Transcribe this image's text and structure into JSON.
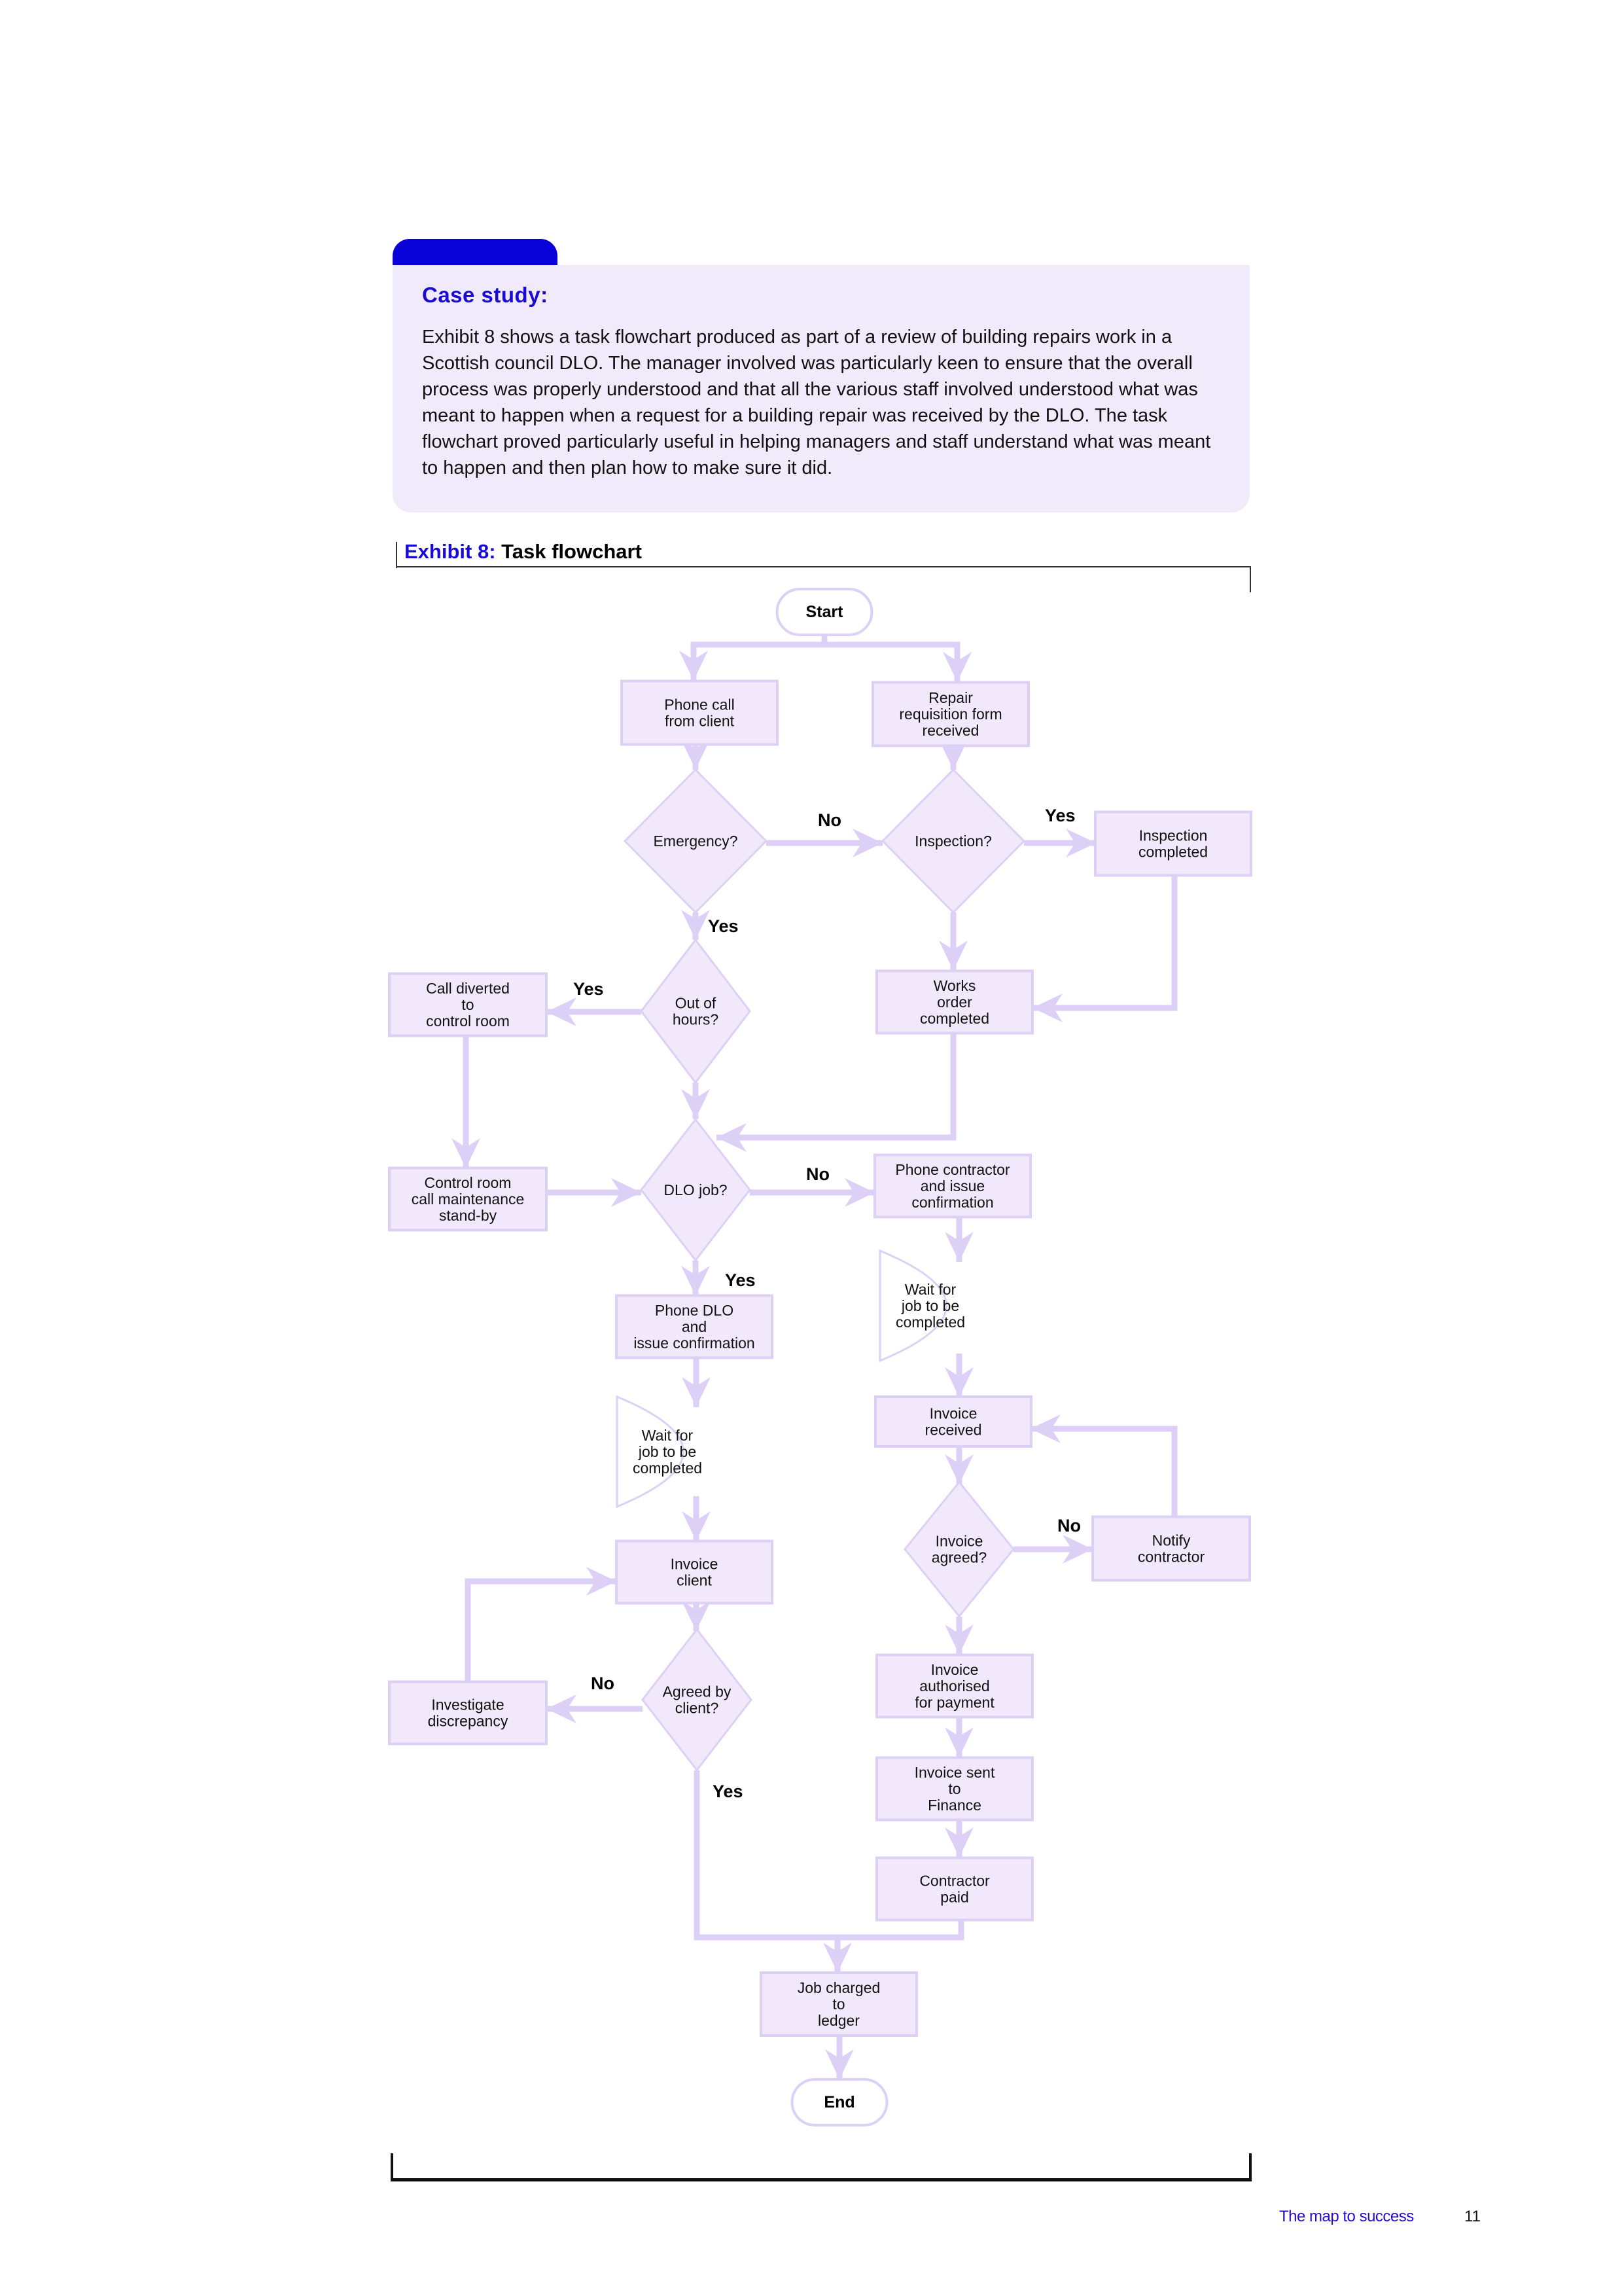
{
  "case_study": {
    "title": "Case study:",
    "body": "Exhibit 8 shows a task flowchart produced as part of a review of building repairs work in a Scottish council DLO. The manager involved was particularly keen to ensure that the overall process was properly understood and that all the various staff involved understood what was meant to happen when a request for a building repair was received by the DLO. The task flowchart proved particularly useful in helping managers and staff understand what was meant to happen and then plan how to make sure it did."
  },
  "exhibit": {
    "number_label": "Exhibit 8:",
    "title": " Task flowchart"
  },
  "colors": {
    "accent_blue": "#1a0ad6",
    "tab_blue": "#0a00d8",
    "case_bg": "#f1eafa",
    "node_fill": "#f1e9fb",
    "node_stroke": "#dcd0f5",
    "arrow": "#ddd0f7"
  },
  "flowchart": {
    "nodes": [
      {
        "id": "start",
        "type": "terminal",
        "lines": [
          "Start"
        ]
      },
      {
        "id": "phone_call",
        "type": "process",
        "lines": [
          "Phone call",
          "from client"
        ]
      },
      {
        "id": "repair_form",
        "type": "process",
        "lines": [
          "Repair",
          "requisition form",
          "received"
        ]
      },
      {
        "id": "emergency",
        "type": "decision",
        "lines": [
          "Emergency?"
        ]
      },
      {
        "id": "inspection",
        "type": "decision",
        "lines": [
          "Inspection?"
        ]
      },
      {
        "id": "inspection_completed",
        "type": "process",
        "lines": [
          "Inspection",
          "completed"
        ]
      },
      {
        "id": "out_of_hours",
        "type": "decision",
        "lines": [
          "Out of",
          "hours?"
        ]
      },
      {
        "id": "call_diverted",
        "type": "process",
        "lines": [
          "Call diverted",
          "to",
          "control room"
        ]
      },
      {
        "id": "works_order",
        "type": "process",
        "lines": [
          "Works",
          "order",
          "completed"
        ]
      },
      {
        "id": "dlo_job",
        "type": "decision",
        "lines": [
          "DLO job?"
        ]
      },
      {
        "id": "control_room",
        "type": "process",
        "lines": [
          "Control room",
          "call maintenance",
          "stand-by"
        ]
      },
      {
        "id": "phone_contractor",
        "type": "process",
        "lines": [
          "Phone contractor",
          "and issue",
          "confirmation"
        ]
      },
      {
        "id": "wait_contractor",
        "type": "delay",
        "lines": [
          "Wait for",
          "job to be",
          "completed"
        ]
      },
      {
        "id": "phone_dlo",
        "type": "process",
        "lines": [
          "Phone DLO",
          "and",
          "issue confirmation"
        ]
      },
      {
        "id": "wait_dlo",
        "type": "delay",
        "lines": [
          "Wait for",
          "job to be",
          "completed"
        ]
      },
      {
        "id": "invoice_received",
        "type": "process",
        "lines": [
          "Invoice",
          "received"
        ]
      },
      {
        "id": "invoice_agreed",
        "type": "decision",
        "lines": [
          "Invoice",
          "agreed?"
        ]
      },
      {
        "id": "notify_contractor",
        "type": "process",
        "lines": [
          "Notify",
          "contractor"
        ]
      },
      {
        "id": "invoice_client",
        "type": "process",
        "lines": [
          "Invoice",
          "client"
        ]
      },
      {
        "id": "agreed_by_client",
        "type": "decision",
        "lines": [
          "Agreed by",
          "client?"
        ]
      },
      {
        "id": "investigate",
        "type": "process",
        "lines": [
          "Investigate",
          "discrepancy"
        ]
      },
      {
        "id": "invoice_authorised",
        "type": "process",
        "lines": [
          "Invoice",
          "authorised",
          "for payment"
        ]
      },
      {
        "id": "invoice_sent",
        "type": "process",
        "lines": [
          "Invoice sent",
          "to",
          "Finance"
        ]
      },
      {
        "id": "contractor_paid",
        "type": "process",
        "lines": [
          "Contractor",
          "paid"
        ]
      },
      {
        "id": "job_charged",
        "type": "process",
        "lines": [
          "Job charged",
          "to",
          "ledger"
        ]
      },
      {
        "id": "end",
        "type": "terminal",
        "lines": [
          "End"
        ]
      }
    ],
    "edges": [
      {
        "from": "start",
        "to": "phone_call",
        "label": ""
      },
      {
        "from": "start",
        "to": "repair_form",
        "label": ""
      },
      {
        "from": "phone_call",
        "to": "emergency",
        "label": ""
      },
      {
        "from": "repair_form",
        "to": "inspection",
        "label": ""
      },
      {
        "from": "emergency",
        "to": "inspection",
        "label": "No"
      },
      {
        "from": "inspection",
        "to": "inspection_completed",
        "label": "Yes"
      },
      {
        "from": "emergency",
        "to": "out_of_hours",
        "label": "Yes"
      },
      {
        "from": "inspection",
        "to": "works_order",
        "label": ""
      },
      {
        "from": "inspection_completed",
        "to": "works_order",
        "label": ""
      },
      {
        "from": "out_of_hours",
        "to": "call_diverted",
        "label": "Yes"
      },
      {
        "from": "out_of_hours",
        "to": "dlo_job",
        "label": ""
      },
      {
        "from": "works_order",
        "to": "dlo_job",
        "label": ""
      },
      {
        "from": "call_diverted",
        "to": "control_room",
        "label": ""
      },
      {
        "from": "control_room",
        "to": "dlo_job",
        "label": ""
      },
      {
        "from": "dlo_job",
        "to": "phone_contractor",
        "label": "No"
      },
      {
        "from": "dlo_job",
        "to": "phone_dlo",
        "label": "Yes"
      },
      {
        "from": "phone_contractor",
        "to": "wait_contractor",
        "label": ""
      },
      {
        "from": "wait_contractor",
        "to": "invoice_received",
        "label": ""
      },
      {
        "from": "phone_dlo",
        "to": "wait_dlo",
        "label": ""
      },
      {
        "from": "wait_dlo",
        "to": "invoice_client",
        "label": ""
      },
      {
        "from": "invoice_received",
        "to": "invoice_agreed",
        "label": ""
      },
      {
        "from": "invoice_agreed",
        "to": "notify_contractor",
        "label": "No"
      },
      {
        "from": "notify_contractor",
        "to": "invoice_received",
        "label": ""
      },
      {
        "from": "invoice_agreed",
        "to": "invoice_authorised",
        "label": ""
      },
      {
        "from": "invoice_client",
        "to": "agreed_by_client",
        "label": ""
      },
      {
        "from": "agreed_by_client",
        "to": "investigate",
        "label": "No"
      },
      {
        "from": "investigate",
        "to": "invoice_client",
        "label": ""
      },
      {
        "from": "agreed_by_client",
        "to": "job_charged",
        "label": "Yes"
      },
      {
        "from": "invoice_authorised",
        "to": "invoice_sent",
        "label": ""
      },
      {
        "from": "invoice_sent",
        "to": "contractor_paid",
        "label": ""
      },
      {
        "from": "contractor_paid",
        "to": "job_charged",
        "label": ""
      },
      {
        "from": "job_charged",
        "to": "end",
        "label": ""
      }
    ]
  },
  "footer": {
    "title": "The map to success",
    "page": "11"
  }
}
